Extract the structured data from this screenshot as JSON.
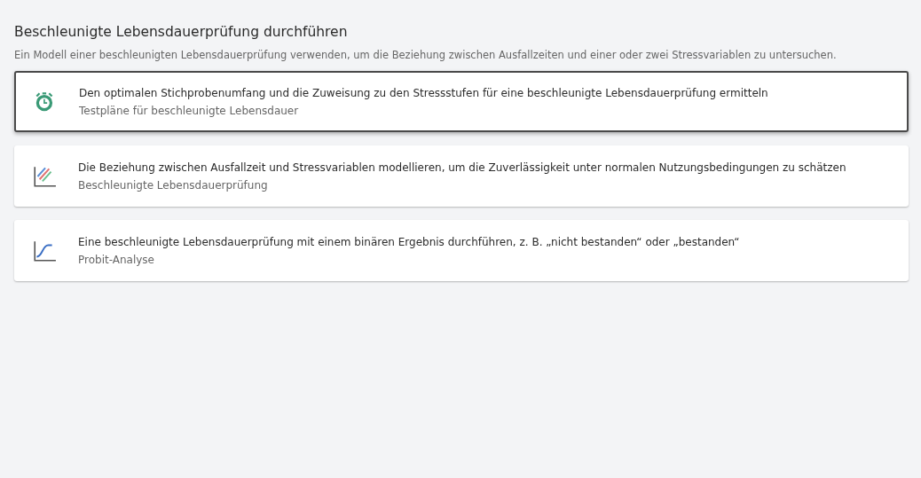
{
  "title": "Beschleunigte Lebensdauerprüfung durchführen",
  "description": "Ein Modell einer beschleunigten Lebensdauerprüfung verwenden, um die Beziehung zwischen Ausfallzeiten und einer oder zwei Stressvariablen zu untersuchen.",
  "options": [
    {
      "kind": "timer",
      "selected": true,
      "heading": "Den optimalen Stichprobenumfang und die Zuweisung zu den Stressstufen für eine beschleunigte Lebensdauerprüfung ermitteln",
      "subtitle": "Testpläne für beschleunigte Lebensdauer"
    },
    {
      "kind": "lines",
      "selected": false,
      "heading": "Die Beziehung zwischen Ausfallzeit und Stressvariablen modellieren, um die Zuverlässigkeit unter normalen Nutzungsbedingungen zu schätzen",
      "subtitle": "Beschleunigte Lebensdauerprüfung"
    },
    {
      "kind": "scurve",
      "selected": false,
      "heading": "Eine beschleunigte Lebensdauerprüfung mit einem binären Ergebnis durchführen, z. B. „nicht bestanden“ oder „bestanden“",
      "subtitle": "Probit-Analyse"
    }
  ]
}
